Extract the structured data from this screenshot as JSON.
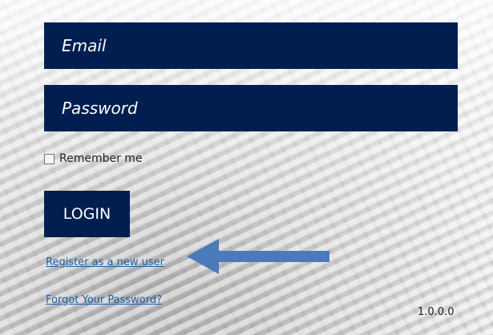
{
  "form": {
    "email_placeholder": "Email",
    "password_placeholder": "Password",
    "remember_label": "Remember me",
    "remember_checked": false,
    "login_label": "LOGIN"
  },
  "links": {
    "register": "Register as a new user",
    "forgot": "Forgot Your Password?"
  },
  "footer": {
    "version": "1.0.0.0"
  },
  "colors": {
    "field_bg": "#001f50",
    "button_bg": "#001f50",
    "link": "#1f5fa8",
    "arrow": "#4a7ab8"
  },
  "annotation": {
    "arrow_icon": "left-arrow-icon"
  }
}
